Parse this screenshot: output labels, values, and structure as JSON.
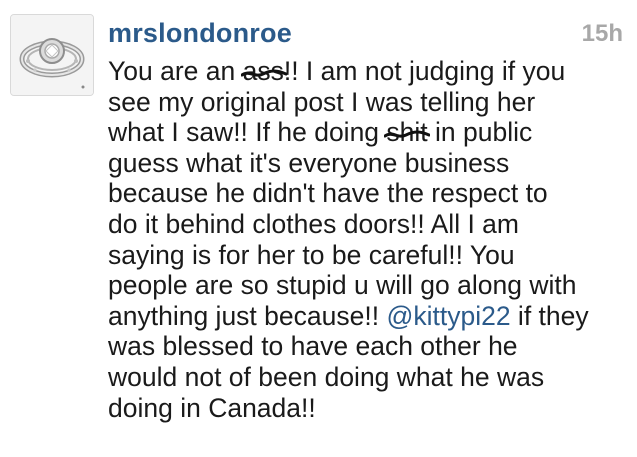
{
  "comment": {
    "username": "mrslondonroe",
    "timestamp": "15h",
    "avatar_icon": "ring-icon",
    "lines": [
      {
        "a": "You are an ",
        "x": "ass",
        "b": "!! I am not judging if you"
      },
      {
        "t": "see my original post I was telling her"
      },
      {
        "a": "what I saw!! If he doing ",
        "x": "shit",
        "b": " in public"
      },
      {
        "t": "guess what it's everyone business"
      },
      {
        "t": "because he didn't have the respect to"
      },
      {
        "t": "do it behind clothes doors!! All I am"
      },
      {
        "t": "saying is for her to be careful!! You"
      },
      {
        "t": "people are so stupid u will go along with"
      },
      {
        "a": "anything just because!! ",
        "m": "@kittypi22",
        "b": " if they"
      },
      {
        "t": "was blessed to have each other he"
      },
      {
        "t": "would not of been doing what he was"
      },
      {
        "t": "doing in Canada!!"
      }
    ]
  },
  "colors": {
    "username": "#2b5a8a",
    "mention": "#2b5a8a",
    "timestamp": "#a8a8a8",
    "text": "#1a1a1a"
  }
}
